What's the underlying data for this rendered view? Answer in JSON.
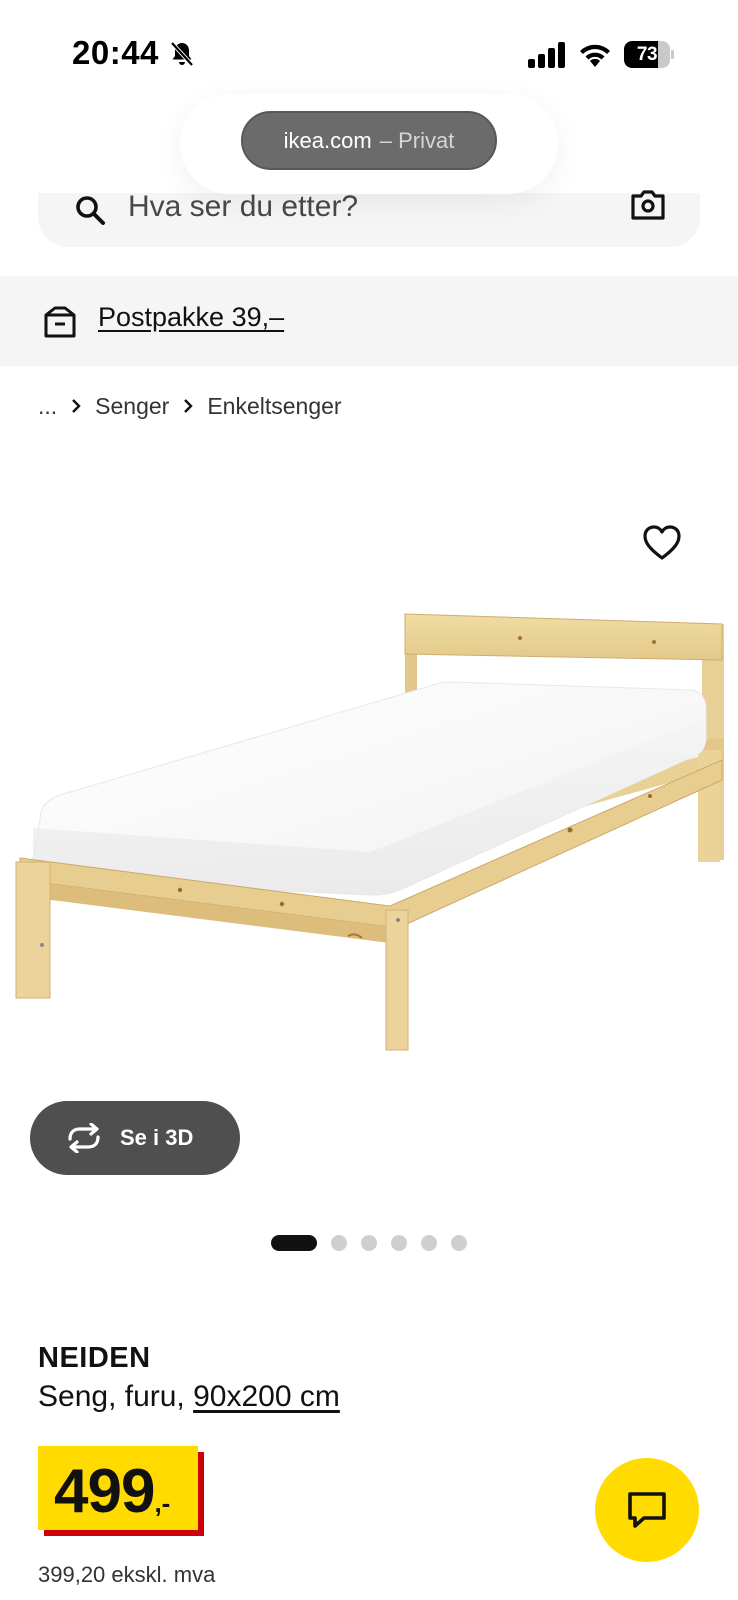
{
  "status_bar": {
    "time": "20:44",
    "battery_level": "73",
    "battery_fraction": 0.73,
    "icons": [
      "bell-off-icon",
      "signal-icon",
      "wifi-icon",
      "battery-icon"
    ]
  },
  "browser": {
    "domain": "ikea.com",
    "mode": "– Privat"
  },
  "search": {
    "placeholder": "Hva ser du etter?",
    "icons": [
      "search-icon",
      "camera-icon"
    ]
  },
  "delivery": {
    "label": "Postpakke 39,–",
    "icon": "box-icon"
  },
  "breadcrumb": {
    "items": [
      "...",
      "Senger",
      "Enkeltsenger"
    ]
  },
  "product": {
    "name": "NEIDEN",
    "description_prefix": "Seng, furu, ",
    "size": "90x200 cm",
    "view_3d_label": "Se i 3D",
    "price": "499",
    "price_suffix": ",-",
    "price_ex_vat": "399,20 ekskl. mva",
    "image_count": 6,
    "active_image": 1
  },
  "colors": {
    "price_yellow": "#ffdb00",
    "price_red": "#cc0008",
    "pill_grey": "#4f4f4f",
    "banner_grey": "#f5f5f5"
  }
}
